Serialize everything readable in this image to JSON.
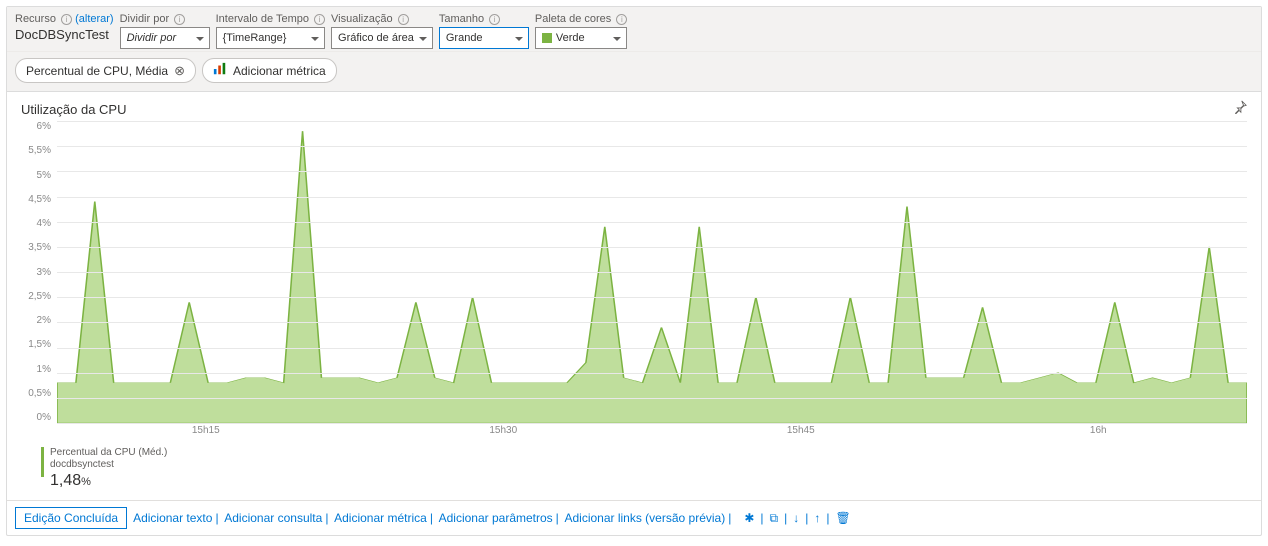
{
  "toolbar": {
    "resource_label": "Recurso",
    "resource_value": "DocDBSyncTest",
    "alter_link": "(alterar)",
    "split_label": "Dividir por",
    "split_value": "Dividir por",
    "time_label": "Intervalo de Tempo",
    "time_value": "{TimeRange}",
    "viz_label": "Visualização",
    "viz_value": "Gráfico de área",
    "size_label": "Tamanho",
    "size_value": "Grande",
    "palette_label": "Paleta de cores",
    "palette_value": "Verde"
  },
  "chips": {
    "metric_chip": "Percentual de CPU, Média",
    "add_metric": "Adicionar métrica"
  },
  "chart": {
    "title": "Utilização da CPU",
    "legend_label": "Percentual da CPU (Méd.)",
    "legend_sub": "docdbsynctest",
    "legend_value": "1,48",
    "legend_unit": "%"
  },
  "bottom": {
    "done": "Edição Concluída",
    "add_text": "Adicionar texto",
    "add_query": "Adicionar consulta",
    "add_metric": "Adicionar métrica",
    "add_params": "Adicionar parâmetros",
    "add_links": "Adicionar links (versão prévia)"
  },
  "chart_data": {
    "type": "area",
    "title": "Utilização da CPU",
    "ylabel": "%",
    "xlabel": "",
    "ylim": [
      0,
      6
    ],
    "y_ticks": [
      "6%",
      "5,5%",
      "5%",
      "4,5%",
      "4%",
      "3,5%",
      "3%",
      "2,5%",
      "2%",
      "1,5%",
      "1%",
      "0,5%",
      "0%"
    ],
    "x_ticks": [
      "15h15",
      "15h30",
      "15h45",
      "16h"
    ],
    "series": [
      {
        "name": "Percentual da CPU (Méd.)",
        "color": "#7cb342",
        "x": [
          0,
          1,
          2,
          3,
          4,
          5,
          6,
          7,
          8,
          9,
          10,
          11,
          12,
          13,
          14,
          15,
          16,
          17,
          18,
          19,
          20,
          21,
          22,
          23,
          24,
          25,
          26,
          27,
          28,
          29,
          30,
          31,
          32,
          33,
          34,
          35,
          36,
          37,
          38,
          39,
          40,
          41,
          42,
          43,
          44,
          45,
          46,
          47,
          48,
          49,
          50,
          51,
          52,
          53,
          54,
          55,
          56,
          57,
          58,
          59,
          60,
          61,
          62,
          63
        ],
        "values": [
          0.8,
          0.8,
          4.4,
          0.8,
          0.8,
          0.8,
          0.8,
          2.4,
          0.8,
          0.8,
          0.9,
          0.9,
          0.8,
          5.8,
          0.9,
          0.9,
          0.9,
          0.8,
          0.9,
          2.4,
          0.9,
          0.8,
          2.5,
          0.8,
          0.8,
          0.8,
          0.8,
          0.8,
          1.2,
          3.9,
          0.9,
          0.8,
          1.9,
          0.8,
          3.9,
          0.8,
          0.8,
          2.5,
          0.8,
          0.8,
          0.8,
          0.8,
          2.5,
          0.8,
          0.8,
          4.3,
          0.9,
          0.9,
          0.9,
          2.3,
          0.8,
          0.8,
          0.9,
          1.0,
          0.8,
          0.8,
          2.4,
          0.8,
          0.9,
          0.8,
          0.9,
          3.5,
          0.8,
          0.8
        ]
      }
    ]
  }
}
